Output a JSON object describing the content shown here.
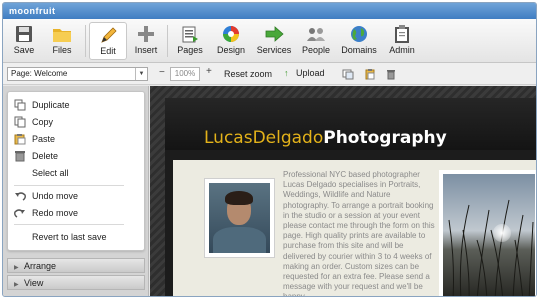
{
  "app": {
    "title": "moonfruit"
  },
  "toolbar": {
    "save": "Save",
    "files": "Files",
    "edit": "Edit",
    "insert": "Insert",
    "pages": "Pages",
    "design": "Design",
    "services": "Services",
    "people": "People",
    "domains": "Domains",
    "admin": "Admin"
  },
  "subbar": {
    "page_select": "Page: Welcome",
    "zoom_value": "100%",
    "reset_zoom": "Reset zoom",
    "upload": "Upload"
  },
  "context_menu": {
    "duplicate": "Duplicate",
    "copy": "Copy",
    "paste": "Paste",
    "delete": "Delete",
    "select_all": "Select all",
    "undo_move": "Undo move",
    "redo_move": "Redo move",
    "revert": "Revert to last save"
  },
  "panels": {
    "arrange": "Arrange",
    "view": "View"
  },
  "site": {
    "title_part1": "LucasDelgado",
    "title_part2": "Photography",
    "bio": "Professional NYC based photographer Lucas Delgado specialises in Portraits, Weddings, Wildlife and Nature photography. To arrange a portrait booking in the studio or a session at your event please contact me through the form on this page. High quality prints are available to purchase from this site and will be delivered by courier within 3 to 4 weeks of making an order. Custom sizes can be requested for an extra fee. Please send a message with your request and we'll be happy"
  },
  "colors": {
    "titlebar": "#4a86c8",
    "accent_gold": "#e3b21a",
    "canvas_bg": "#333333"
  }
}
